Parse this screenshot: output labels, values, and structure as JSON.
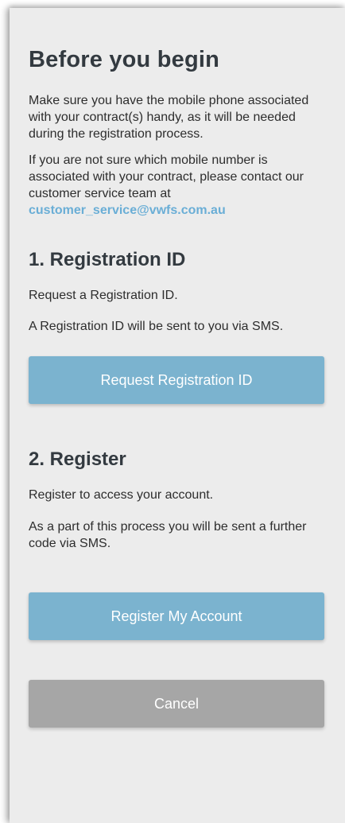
{
  "title": "Before you begin",
  "intro": {
    "paragraph1": "Make sure you have the mobile phone associated with your contract(s) handy, as it will be needed during the registration process.",
    "paragraph2_text": "If you are not sure which mobile number is associated with your contract, please contact our customer service team at ",
    "email": "customer_service@vwfs.com.au"
  },
  "step1": {
    "heading": "1. Registration ID",
    "line1": "Request a Registration ID.",
    "line2": "A Registration ID will be sent to you via SMS.",
    "button_label": "Request Registration ID"
  },
  "step2": {
    "heading": "2. Register",
    "line1": "Register to access your account.",
    "line2": "As a part of this process you will be sent a further code via SMS.",
    "button_label": "Register My Account"
  },
  "cancel_label": "Cancel",
  "colors": {
    "panel_background": "#ececec",
    "heading": "#333a40",
    "link": "#6aaed6",
    "primary_button": "#7bb3cf",
    "secondary_button": "#a6a6a6"
  }
}
